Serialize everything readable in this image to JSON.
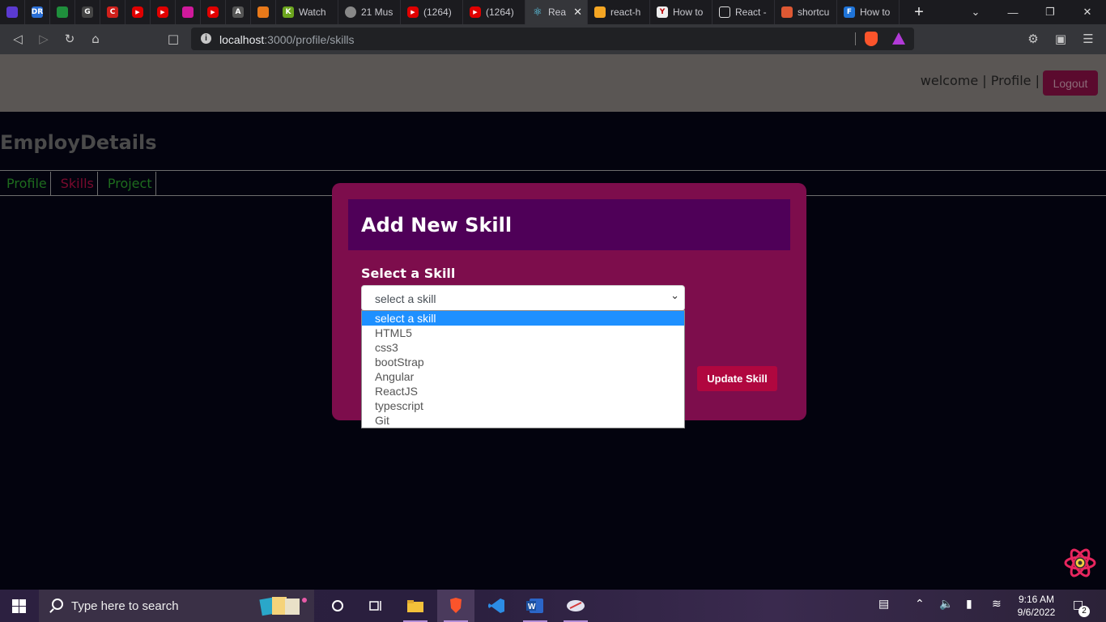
{
  "browser": {
    "tabs": [
      {
        "label": "",
        "icon": "tor-icon",
        "color": "#5b3ad1"
      },
      {
        "label": "",
        "icon": "dr-icon",
        "color": "#2a6fd6",
        "glyph": "DR"
      },
      {
        "label": "",
        "icon": "game-icon",
        "color": "#1f8f3c"
      },
      {
        "label": "",
        "icon": "g-icon",
        "color": "#444",
        "glyph": "G"
      },
      {
        "label": "",
        "icon": "c-icon",
        "color": "#d0201b",
        "glyph": "C"
      },
      {
        "label": "",
        "icon": "youtube-icon",
        "color": "#e00000"
      },
      {
        "label": "",
        "icon": "youtube-icon",
        "color": "#e00000"
      },
      {
        "label": "",
        "icon": "graphql-icon",
        "color": "#d0199c"
      },
      {
        "label": "",
        "icon": "youtube-icon",
        "color": "#e00000"
      },
      {
        "label": "",
        "icon": "a-icon",
        "color": "#555",
        "glyph": "A"
      },
      {
        "label": "",
        "icon": "bookmark-icon",
        "color": "#e8791a"
      },
      {
        "label": "Watch",
        "icon": "k-icon",
        "color": "#6ca51e",
        "glyph": "K"
      },
      {
        "label": "21 Mus",
        "icon": "globe-icon",
        "color": "#777"
      },
      {
        "label": "(1264)",
        "icon": "youtube-icon",
        "color": "#e00000"
      },
      {
        "label": "(1264)",
        "icon": "youtube-icon",
        "color": "#e00000"
      },
      {
        "label": "Rea",
        "icon": "react-icon",
        "color": "#35363a",
        "active": true
      },
      {
        "label": "react-h",
        "icon": "firebase-icon",
        "color": "#f5a623"
      },
      {
        "label": "How to",
        "icon": "y-icon",
        "color": "#eee",
        "glyph": "Y"
      },
      {
        "label": "React -",
        "icon": "square-icon",
        "color": "#1b1b1f"
      },
      {
        "label": "shortcu",
        "icon": "duck-icon",
        "color": "#de5833"
      },
      {
        "label": "How to",
        "icon": "f-icon",
        "color": "#1e73d8",
        "glyph": "F"
      }
    ],
    "address": {
      "host": "localhost",
      "path": ":3000/profile/skills"
    }
  },
  "app": {
    "header": {
      "welcome": "welcome",
      "profile_link": "Profile",
      "sep": "|",
      "logout": "Logout"
    },
    "brand": "EmployDetails",
    "nav": [
      {
        "label": "Profile",
        "active": false
      },
      {
        "label": "Skills",
        "active": true
      },
      {
        "label": "Project",
        "active": false
      }
    ],
    "modal": {
      "title": "Add New Skill",
      "field_label": "Select a Skill",
      "selected": "select a skill",
      "options": [
        "select a skill",
        "HTML5",
        "css3",
        "bootStrap",
        "Angular",
        "ReactJS",
        "typescript",
        "Git"
      ],
      "update_button": "Update Skill"
    }
  },
  "taskbar": {
    "search_placeholder": "Type here to search",
    "time": "9:16 AM",
    "date": "9/6/2022",
    "notification_count": "2"
  },
  "colors": {
    "modal_bg": "#7d0d4c",
    "modal_header": "#4f0058",
    "button": "#b0073f",
    "nav_active": "#7a0a2e",
    "nav_inactive": "#1e6b1e"
  }
}
